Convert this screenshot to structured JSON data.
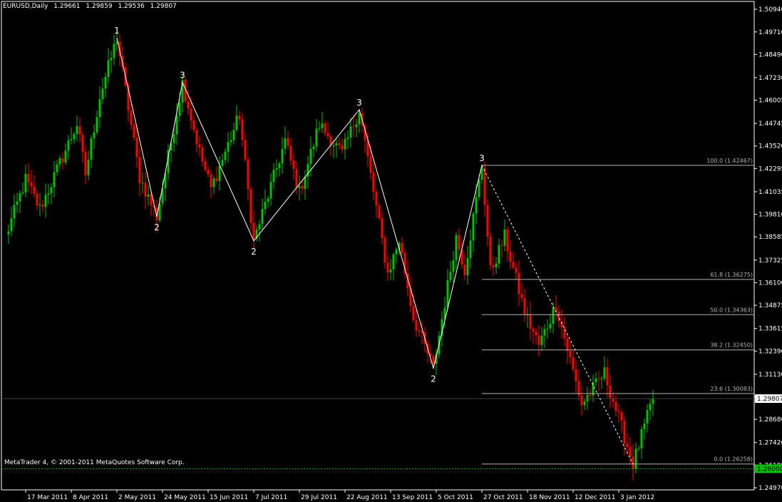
{
  "header": {
    "symbol": "EURUSD,Daily",
    "open": "1.29661",
    "high": "1.29859",
    "low": "1.29536",
    "close": "1.29807"
  },
  "copyright": "MetaTrader 4, © 2001-2011 MetaQuotes Software Corp.",
  "colors": {
    "background": "#000000",
    "axis": "#ffffff",
    "bull": "#00c000",
    "bear": "#ff0000",
    "fib": "#b4b4b4",
    "bid_tag": "#ffffff",
    "ask_tag": "#00c000"
  },
  "chart_data": {
    "type": "candlestick",
    "symbol": "EURUSD",
    "timeframe": "Daily",
    "ylim": [
      1.2497,
      1.5094
    ],
    "y_ticks": [
      "1.50940",
      "1.49710",
      "1.48490",
      "1.47230",
      "1.46005",
      "1.44745",
      "1.43520",
      "1.42295",
      "1.41035",
      "1.39810",
      "1.38585",
      "1.37325",
      "1.36100",
      "1.34875",
      "1.33615",
      "1.32390",
      "1.31130",
      "1.29905",
      "1.28680",
      "1.27420",
      "1.26195",
      "1.24970"
    ],
    "x_ticks": [
      "17 Mar 2011",
      "8 Apr 2011",
      "2 May 2011",
      "24 May 2011",
      "15 Jun 2011",
      "7 Jul 2011",
      "29 Jul 2011",
      "22 Aug 2011",
      "13 Sep 2011",
      "5 Oct 2011",
      "27 Oct 2011",
      "18 Nov 2011",
      "12 Dec 2011",
      "3 Jan 2012"
    ],
    "current_bid": "1.29807",
    "ask_tag": "1.26000",
    "fibonacci": [
      {
        "label": "100.0 (1.42467)",
        "price": 1.42467
      },
      {
        "label": "61.8 (1.36275)",
        "price": 1.36275
      },
      {
        "label": "50.0 (1.34363)",
        "price": 1.34363
      },
      {
        "label": "38.2 (1.32450)",
        "price": 1.3245
      },
      {
        "label": "23.6 (1.30083)",
        "price": 1.30083
      },
      {
        "label": "0.0 (1.26258)",
        "price": 1.26258
      }
    ],
    "wave_lines": [
      {
        "date": "2 May 2011",
        "price": 1.4939
      },
      {
        "date": "20 May 2011",
        "price": 1.3968
      },
      {
        "date": "2 Jun 2011",
        "price": 1.4697
      },
      {
        "date": "7 Jul 2011",
        "price": 1.3837
      },
      {
        "date": "29 Aug 2011",
        "price": 1.4549
      },
      {
        "date": "4 Oct 2011",
        "price": 1.3146
      },
      {
        "date": "27 Oct 2011",
        "price": 1.4247
      }
    ],
    "dotted_line": [
      {
        "date": "27 Oct 2011",
        "price": 1.4247
      },
      {
        "date": "10 Jan 2012",
        "price": 1.2626
      }
    ],
    "wave_labels": [
      {
        "text": "1",
        "date": "2 May 2011",
        "price": 1.4939,
        "pos": "above"
      },
      {
        "text": "2",
        "date": "20 May 2011",
        "price": 1.3968,
        "pos": "below"
      },
      {
        "text": "3",
        "date": "2 Jun 2011",
        "price": 1.4697,
        "pos": "above"
      },
      {
        "text": "2",
        "date": "7 Jul 2011",
        "price": 1.3837,
        "pos": "below"
      },
      {
        "text": "3",
        "date": "29 Aug 2011",
        "price": 1.4549,
        "pos": "above"
      },
      {
        "text": "2",
        "date": "4 Oct 2011",
        "price": 1.3146,
        "pos": "below"
      },
      {
        "text": "3",
        "date": "27 Oct 2011",
        "price": 1.4247,
        "pos": "above"
      }
    ],
    "pivots": [
      {
        "date": "8 Mar 2011",
        "price": 1.386
      },
      {
        "date": "17 Mar 2011",
        "price": 1.417
      },
      {
        "date": "24 Mar 2011",
        "price": 1.401
      },
      {
        "date": "12 Apr 2011",
        "price": 1.447
      },
      {
        "date": "15 Apr 2011",
        "price": 1.42
      },
      {
        "date": "22 Apr 2011",
        "price": 1.462
      },
      {
        "date": "2 May 2011",
        "price": 1.4939
      },
      {
        "date": "12 May 2011",
        "price": 1.418
      },
      {
        "date": "20 May 2011",
        "price": 1.3968
      },
      {
        "date": "2 Jun 2011",
        "price": 1.4697
      },
      {
        "date": "10 Jun 2011",
        "price": 1.432
      },
      {
        "date": "16 Jun 2011",
        "price": 1.412
      },
      {
        "date": "30 Jun 2011",
        "price": 1.452
      },
      {
        "date": "7 Jul 2011",
        "price": 1.3837
      },
      {
        "date": "22 Jul 2011",
        "price": 1.438
      },
      {
        "date": "29 Jul 2011",
        "price": 1.41
      },
      {
        "date": "9 Aug 2011",
        "price": 1.447
      },
      {
        "date": "19 Aug 2011",
        "price": 1.431
      },
      {
        "date": "29 Aug 2011",
        "price": 1.4549
      },
      {
        "date": "12 Sep 2011",
        "price": 1.366
      },
      {
        "date": "16 Sep 2011",
        "price": 1.384
      },
      {
        "date": "23 Sep 2011",
        "price": 1.342
      },
      {
        "date": "4 Oct 2011",
        "price": 1.3146
      },
      {
        "date": "14 Oct 2011",
        "price": 1.386
      },
      {
        "date": "19 Oct 2011",
        "price": 1.368
      },
      {
        "date": "27 Oct 2011",
        "price": 1.4247
      },
      {
        "date": "1 Nov 2011",
        "price": 1.367
      },
      {
        "date": "8 Nov 2011",
        "price": 1.386
      },
      {
        "date": "17 Nov 2011",
        "price": 1.345
      },
      {
        "date": "24 Nov 2011",
        "price": 1.327
      },
      {
        "date": "2 Dec 2011",
        "price": 1.349
      },
      {
        "date": "15 Dec 2011",
        "price": 1.295
      },
      {
        "date": "27 Dec 2011",
        "price": 1.312
      },
      {
        "date": "10 Jan 2012",
        "price": 1.2626
      },
      {
        "date": "19 Jan 2012",
        "price": 1.29807
      }
    ]
  }
}
